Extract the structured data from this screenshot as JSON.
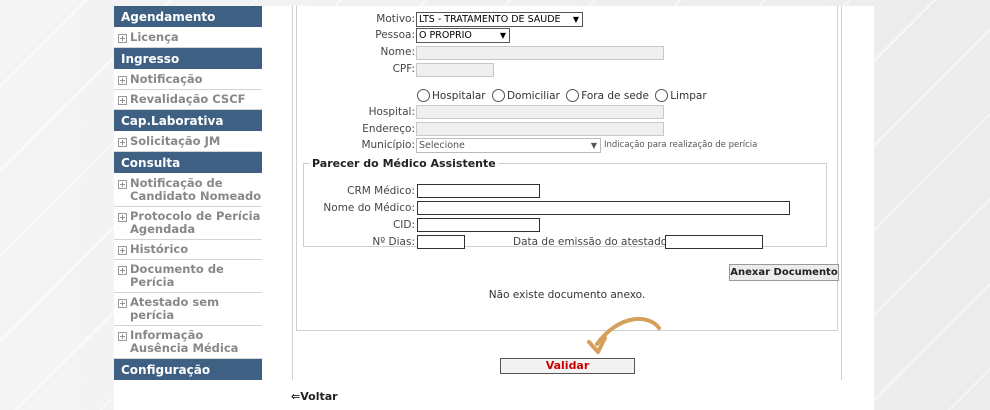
{
  "sidebar": {
    "sections": [
      {
        "title": "Agendamento",
        "items": [
          "Licença"
        ]
      },
      {
        "title": "Ingresso",
        "items": [
          "Notificação",
          "Revalidação CSCF"
        ]
      },
      {
        "title": "Cap.Laborativa",
        "items": [
          "Solicitação JM"
        ]
      },
      {
        "title": "Consulta",
        "items": [
          "Notificação de Candidato Nomeado",
          "Protocolo de Perícia Agendada",
          "Histórico",
          "Documento de Perícia",
          "Atestado sem perícia",
          "Informação Ausência Médica"
        ]
      },
      {
        "title": "Configuração",
        "items": []
      }
    ]
  },
  "form": {
    "motivo_label": "Motivo:",
    "motivo_value": "LTS - TRATAMENTO DE SAUDE",
    "pessoa_label": "Pessoa:",
    "pessoa_value": "O PROPRIO",
    "nome_label": "Nome:",
    "cpf_label": "CPF:",
    "radio_hospitalar": "Hospitalar",
    "radio_domiciliar": "Domiciliar",
    "radio_fora_sede": "Fora de sede",
    "radio_limpar": "Limpar",
    "hospital_label": "Hospital:",
    "endereco_label": "Endereço:",
    "municipio_label": "Município:",
    "municipio_value": "Selecione",
    "municipio_hint": "Indicação para realização de perícia"
  },
  "parecer": {
    "legend": "Parecer do Médico Assistente",
    "crm_label": "CRM Médico:",
    "nome_medico_label": "Nome do Médico:",
    "cid_label": "CID:",
    "dias_label": "Nº Dias:",
    "data_emissao_label": "Data de emissão do atestado:"
  },
  "attach_button": "Anexar Documento",
  "no_document_text": "Não existe documento anexo.",
  "validate_button": "Validar",
  "back_link": "Voltar"
}
